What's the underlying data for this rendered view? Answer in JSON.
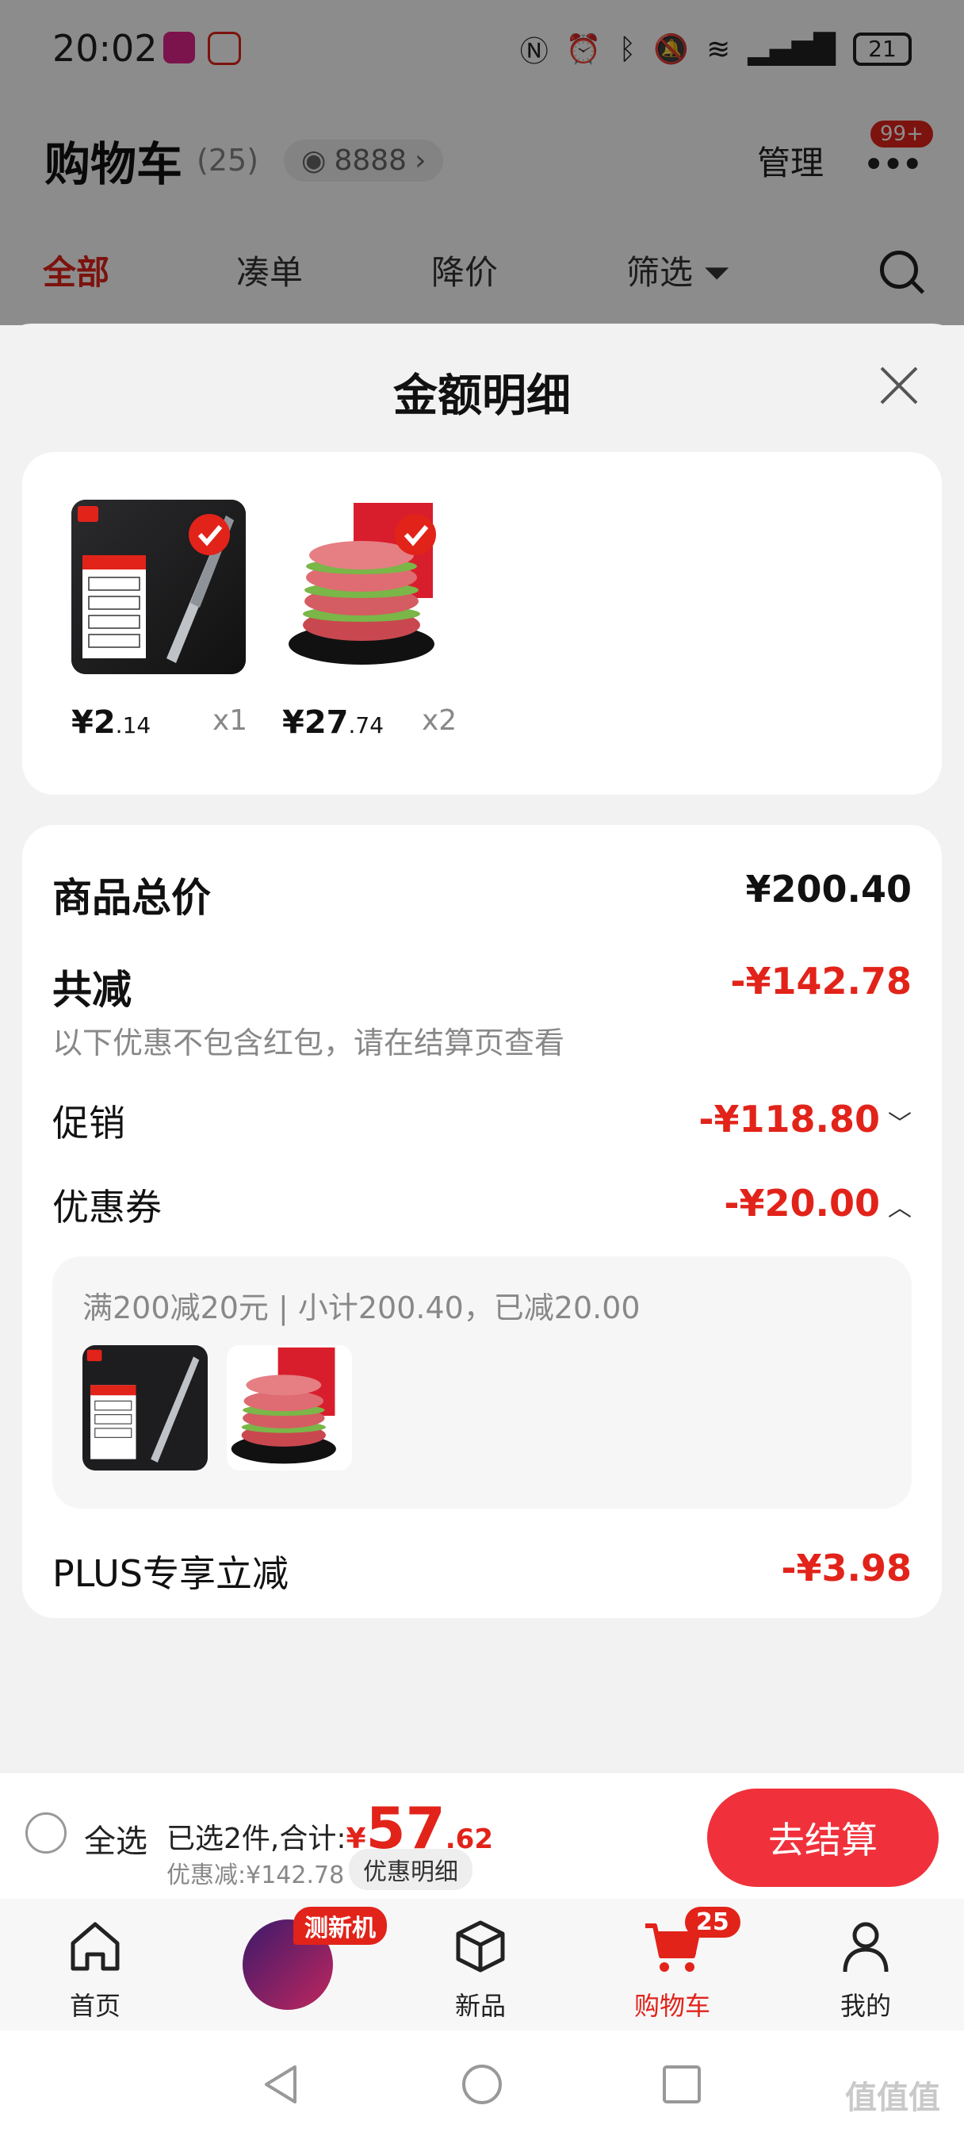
{
  "status_bar": {
    "time": "20:02",
    "battery": "21"
  },
  "background": {
    "title": "购物车",
    "count": "(25)",
    "views": "8888",
    "manage": "管理",
    "badge": "99+",
    "tabs": [
      "全部",
      "凑单",
      "降价",
      "筛选"
    ]
  },
  "sheet": {
    "title": "金额明细",
    "products": [
      {
        "price_int": "¥2",
        "price_dec": ".14",
        "qty": "x1"
      },
      {
        "price_int": "¥27",
        "price_dec": ".74",
        "qty": "x2"
      }
    ],
    "total_label": "商品总价",
    "total_value": "¥200.40",
    "reduce_label": "共减",
    "reduce_value": "-¥142.78",
    "reduce_note": "以下优惠不包含红包，请在结算页查看",
    "promo_label": "促销",
    "promo_value": "-¥118.80",
    "coupon_label": "优惠券",
    "coupon_value": "-¥20.00",
    "coupon_detail": "满200减20元 | 小计200.40，已减20.00",
    "plus_label": "PLUS专享立减",
    "plus_value": "-¥3.98"
  },
  "checkout": {
    "select_all": "全选",
    "summary_prefix": "已选2件,合计:",
    "yen": "¥",
    "total_int": "57",
    "total_dec": ".62",
    "discount": "优惠减:¥142.78",
    "detail_chip": "优惠明细",
    "button": "去结算"
  },
  "tabbar": {
    "home": "首页",
    "promo_tag": "测新机",
    "new": "新品",
    "cart": "购物车",
    "cart_badge": "25",
    "me": "我的"
  },
  "watermark": "值值值",
  "colors": {
    "accent": "#e2231a",
    "button": "#f0313b"
  }
}
